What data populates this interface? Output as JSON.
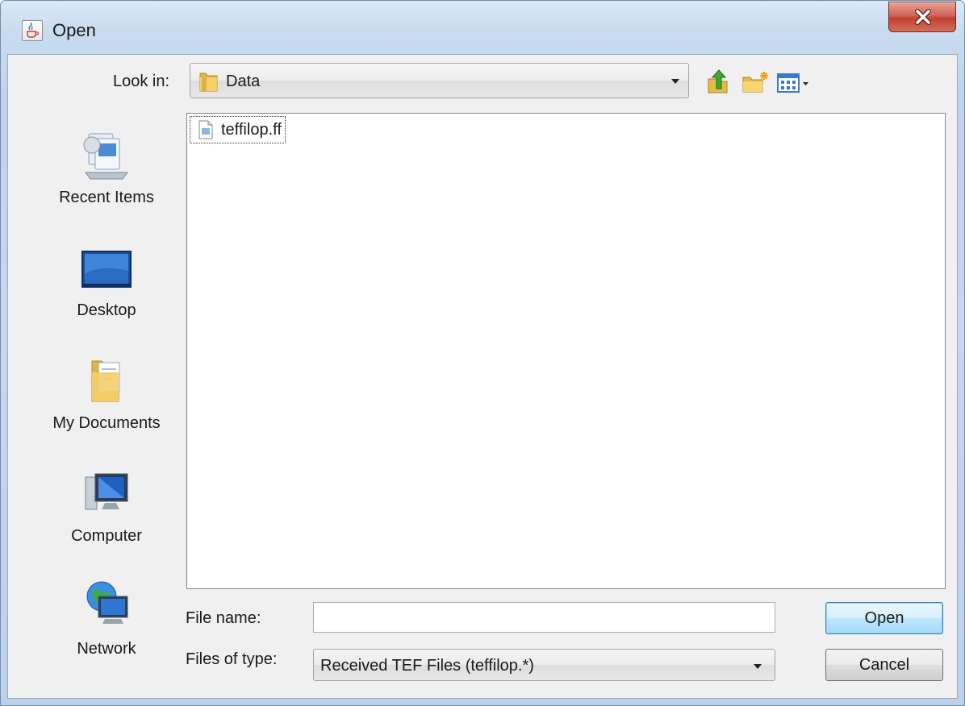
{
  "window": {
    "title": "Open",
    "close_glyph": "X"
  },
  "icons": {
    "app": "java-cup-icon",
    "close": "close-icon",
    "folder": "folder-icon",
    "up": "up-one-level-icon",
    "new_folder": "new-folder-icon",
    "view_menu": "view-menu-icon",
    "file": "document-icon"
  },
  "look_in": {
    "label": "Look in:",
    "value": "Data"
  },
  "places": [
    {
      "label": "Recent Items",
      "icon": "recent-items-icon"
    },
    {
      "label": "Desktop",
      "icon": "desktop-icon"
    },
    {
      "label": "My Documents",
      "icon": "my-documents-icon"
    },
    {
      "label": "Computer",
      "icon": "computer-icon"
    },
    {
      "label": "Network",
      "icon": "network-icon"
    }
  ],
  "files": [
    {
      "name": "teffilop.ff",
      "icon": "document-icon"
    }
  ],
  "file_name": {
    "label": "File name:",
    "value": ""
  },
  "file_type": {
    "label": "Files of type:",
    "value": "Received TEF Files (teffilop.*)"
  },
  "buttons": {
    "open": "Open",
    "cancel": "Cancel"
  },
  "colors": {
    "title_bar": "#c8dbef",
    "close_button": "#c2402f",
    "default_button_border": "#3c7fb1",
    "panel": "#f0f0f0"
  }
}
